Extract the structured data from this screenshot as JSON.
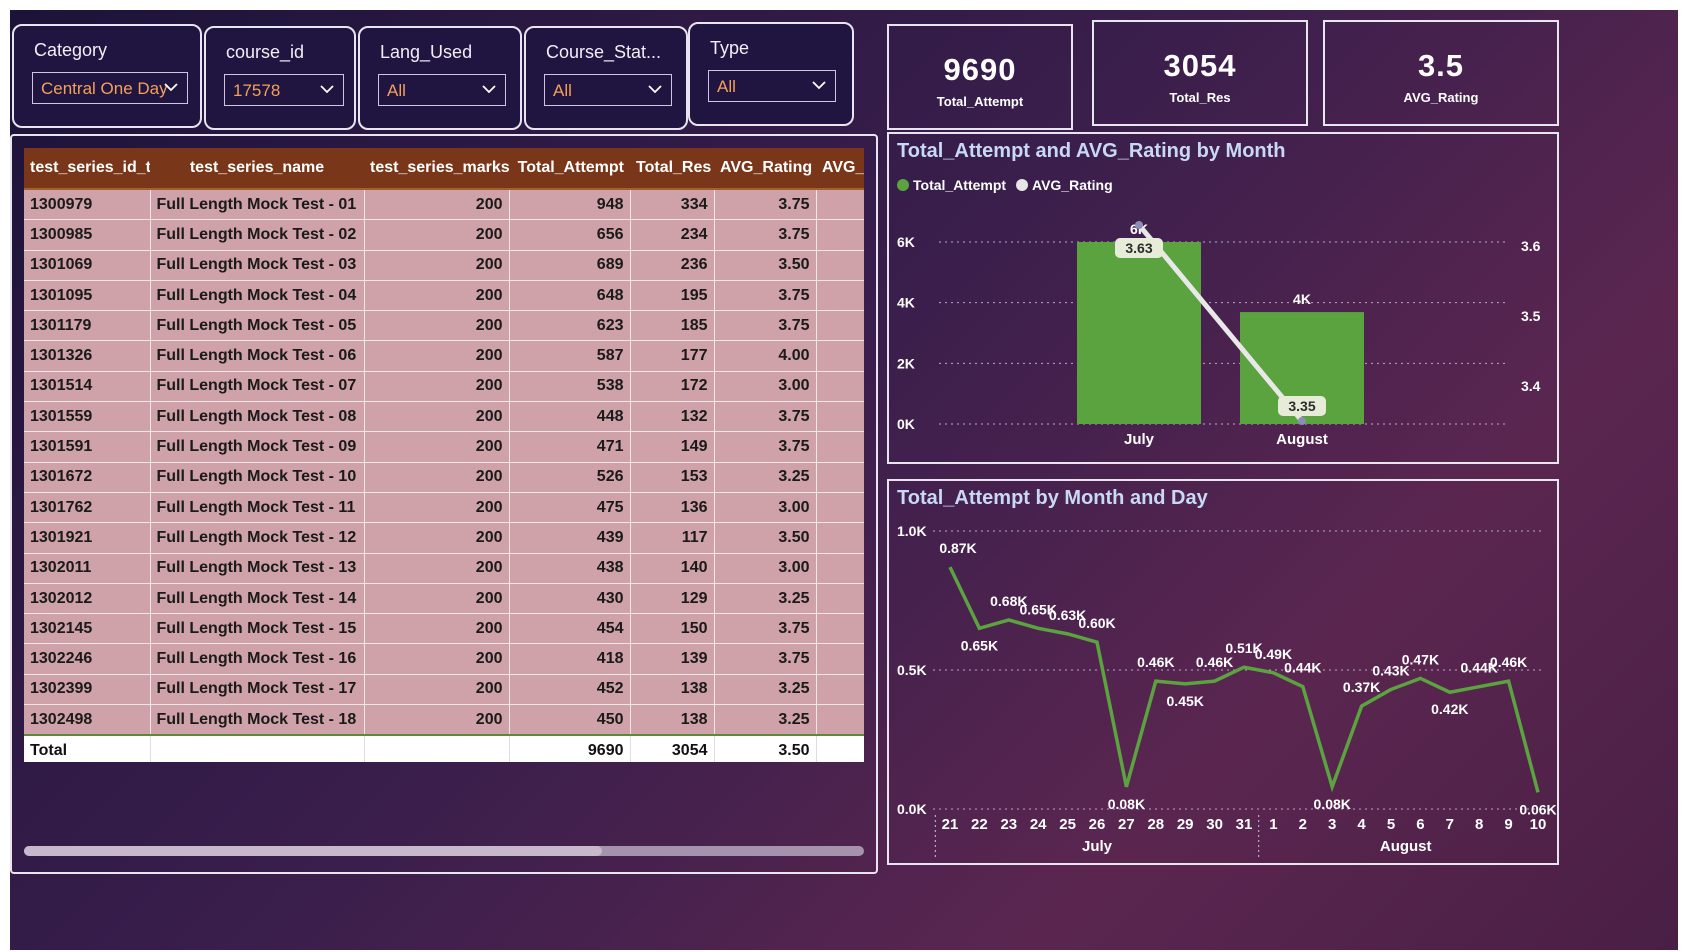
{
  "slicers": [
    {
      "title": "Category",
      "value": "Central One Day"
    },
    {
      "title": "course_id",
      "value": "17578"
    },
    {
      "title": "Lang_Used",
      "value": "All"
    },
    {
      "title": "Course_Stat...",
      "value": "All"
    },
    {
      "title": "Type",
      "value": "All"
    }
  ],
  "kpis": [
    {
      "value": "9690",
      "label": "Total_Attempt"
    },
    {
      "value": "3054",
      "label": "Total_Res"
    },
    {
      "value": "3.5",
      "label": "AVG_Rating"
    }
  ],
  "table": {
    "columns": [
      "test_series_id_t",
      "test_series_name",
      "test_series_marks",
      "Total_Attempt",
      "Total_Res",
      "AVG_Rating",
      "AVG_M"
    ],
    "rows": [
      [
        "1300979",
        "Full Length Mock Test - 01",
        "200",
        "948",
        "334",
        "3.75"
      ],
      [
        "1300985",
        "Full Length Mock Test - 02",
        "200",
        "656",
        "234",
        "3.75"
      ],
      [
        "1301069",
        "Full Length Mock Test - 03",
        "200",
        "689",
        "236",
        "3.50"
      ],
      [
        "1301095",
        "Full Length Mock Test - 04",
        "200",
        "648",
        "195",
        "3.75"
      ],
      [
        "1301179",
        "Full Length Mock Test - 05",
        "200",
        "623",
        "185",
        "3.75"
      ],
      [
        "1301326",
        "Full Length Mock Test - 06",
        "200",
        "587",
        "177",
        "4.00"
      ],
      [
        "1301514",
        "Full Length Mock Test - 07",
        "200",
        "538",
        "172",
        "3.00"
      ],
      [
        "1301559",
        "Full Length Mock Test - 08",
        "200",
        "448",
        "132",
        "3.75"
      ],
      [
        "1301591",
        "Full Length Mock Test - 09",
        "200",
        "471",
        "149",
        "3.75"
      ],
      [
        "1301672",
        "Full Length Mock Test - 10",
        "200",
        "526",
        "153",
        "3.25"
      ],
      [
        "1301762",
        "Full Length Mock Test - 11",
        "200",
        "475",
        "136",
        "3.00"
      ],
      [
        "1301921",
        "Full Length Mock Test - 12",
        "200",
        "439",
        "117",
        "3.50"
      ],
      [
        "1302011",
        "Full Length Mock Test - 13",
        "200",
        "438",
        "140",
        "3.00"
      ],
      [
        "1302012",
        "Full Length Mock Test - 14",
        "200",
        "430",
        "129",
        "3.25"
      ],
      [
        "1302145",
        "Full Length Mock Test - 15",
        "200",
        "454",
        "150",
        "3.75"
      ],
      [
        "1302246",
        "Full Length Mock Test - 16",
        "200",
        "418",
        "139",
        "3.75"
      ],
      [
        "1302399",
        "Full Length Mock Test - 17",
        "200",
        "452",
        "138",
        "3.25"
      ],
      [
        "1302498",
        "Full Length Mock Test - 18",
        "200",
        "450",
        "138",
        "3.25"
      ]
    ],
    "total": [
      "Total",
      "",
      "",
      "9690",
      "3054",
      "3.50"
    ]
  },
  "colors": {
    "bar_green": "#5aa33f",
    "line_white": "#e8e8e8",
    "title_blue": "#c9d8f5",
    "slicer_value_orange": "#f3a05a"
  },
  "chart_data": [
    {
      "type": "bar",
      "title": "Total_Attempt and AVG_Rating by Month",
      "legend": [
        "Total_Attempt",
        "AVG_Rating"
      ],
      "legend_position": "top-left",
      "categories": [
        "July",
        "August"
      ],
      "series": [
        {
          "name": "Total_Attempt",
          "type": "bar",
          "values": [
            6000,
            3690
          ],
          "data_labels": [
            "6K",
            "4K"
          ],
          "axis": "left"
        },
        {
          "name": "AVG_Rating",
          "type": "line",
          "values": [
            3.63,
            3.35
          ],
          "data_labels": [
            "3.63",
            "3.35"
          ],
          "axis": "right"
        }
      ],
      "ylim": [
        0,
        6000
      ],
      "y_ticks": [
        "0K",
        "2K",
        "4K",
        "6K"
      ],
      "y2_ticks": [
        "3.4",
        "3.5",
        "3.6"
      ],
      "grid": true
    },
    {
      "type": "line",
      "title": "Total_Attempt by Month and Day",
      "x": [
        "21",
        "22",
        "23",
        "24",
        "25",
        "26",
        "27",
        "28",
        "29",
        "30",
        "31",
        "1",
        "2",
        "3",
        "4",
        "5",
        "6",
        "7",
        "8",
        "9",
        "10"
      ],
      "groups": [
        {
          "label": "July",
          "span": 11
        },
        {
          "label": "August",
          "span": 10
        }
      ],
      "values": [
        0.87,
        0.65,
        0.68,
        0.65,
        0.63,
        0.6,
        0.08,
        0.46,
        0.45,
        0.46,
        0.51,
        0.49,
        0.44,
        0.08,
        0.37,
        0.43,
        0.47,
        0.42,
        0.44,
        0.46,
        0.06
      ],
      "labels": [
        "0.87K",
        "0.65K",
        "0.68K",
        "0.65K",
        "0.63K",
        "0.60K",
        "0.08K",
        "0.46K",
        "0.45K",
        "0.46K",
        "0.51K",
        "0.49K",
        "0.44K",
        "0.08K",
        "0.37K",
        "0.43K",
        "0.47K",
        "0.42K",
        "0.44K",
        "0.46K",
        "0.06K"
      ],
      "ylim": [
        0,
        1.0
      ],
      "y_ticks": [
        "0.0K",
        "0.5K",
        "1.0K"
      ],
      "grid": true
    }
  ]
}
